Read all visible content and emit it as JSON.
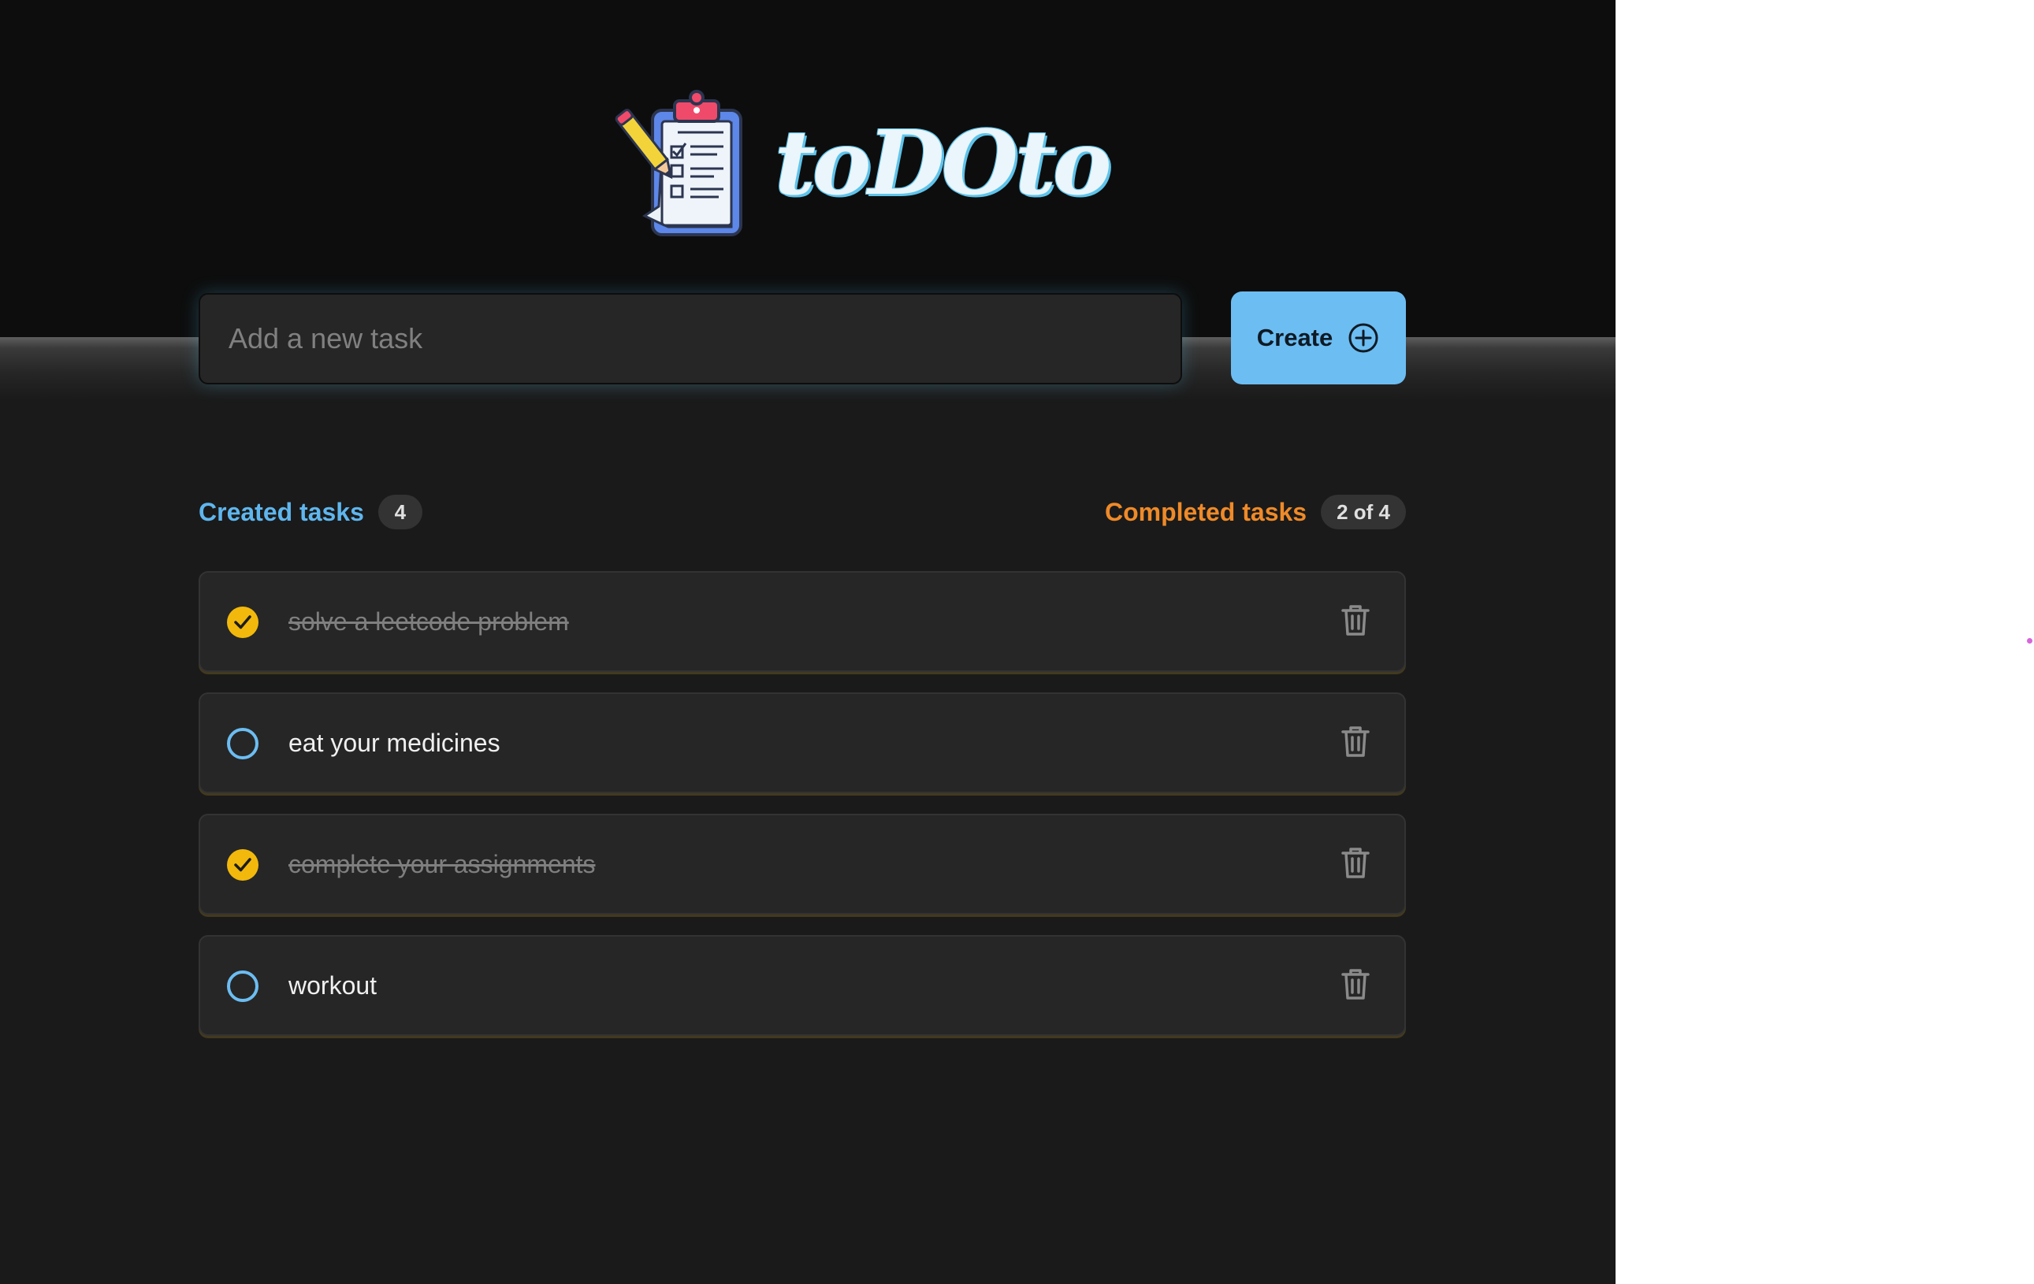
{
  "app": {
    "brand": "toDOto",
    "logo_icon": "clipboard-checklist-pencil-icon",
    "colors": {
      "background": "#1a1a1a",
      "header": "#0d0d0d",
      "accent_blue": "#6cbdf2",
      "accent_orange": "#ee8a29",
      "check_yellow": "#f2b90c"
    }
  },
  "new_task": {
    "value": "",
    "placeholder": "Add a new task"
  },
  "create_button": {
    "label": "Create",
    "icon": "plus-circle-icon"
  },
  "counters": {
    "created_label": "Created tasks",
    "created_count": "4",
    "completed_label": "Completed tasks",
    "completed_count": "2 of 4"
  },
  "tasks": [
    {
      "text": "solve a leetcode problem",
      "completed": true,
      "delete_icon": "trash-icon"
    },
    {
      "text": "eat your medicines",
      "completed": false,
      "delete_icon": "trash-icon"
    },
    {
      "text": "complete your assignments",
      "completed": true,
      "delete_icon": "trash-icon"
    },
    {
      "text": "workout",
      "completed": false,
      "delete_icon": "trash-icon"
    }
  ]
}
